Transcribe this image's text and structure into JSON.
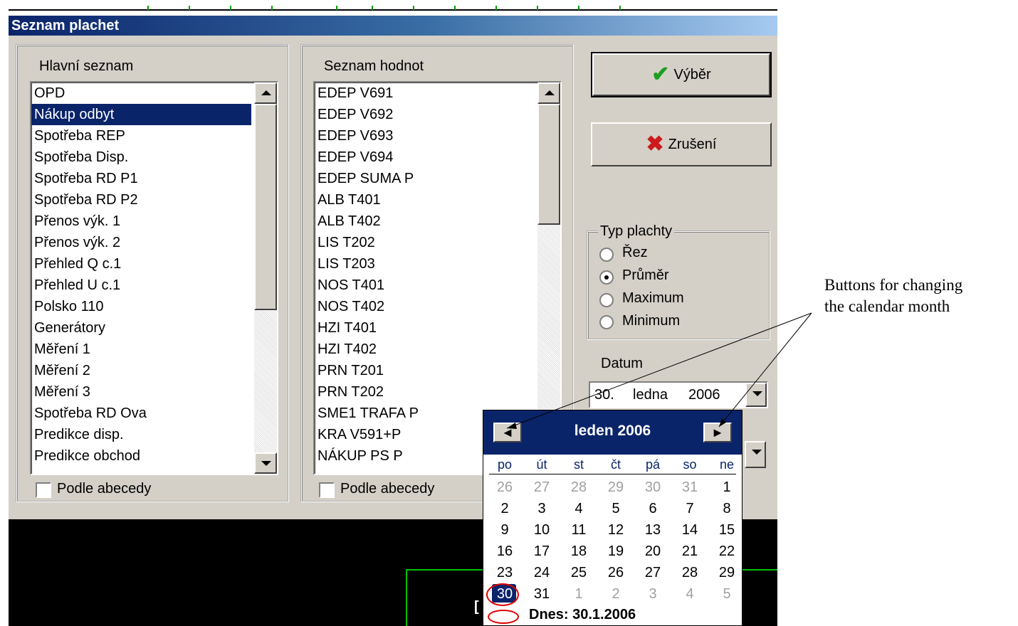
{
  "window": {
    "title": "Seznam plachet"
  },
  "main_list": {
    "label": "Hlavní seznam",
    "items": [
      "OPD",
      "Nákup odbyt",
      "Spotřeba REP",
      "Spotřeba Disp.",
      "Spotřeba RD P1",
      "Spotřeba RD P2",
      "Přenos výk. 1",
      "Přenos výk. 2",
      "Přehled Q c.1",
      "Přehled U c.1",
      "Polsko 110",
      "Generátory",
      "Měření 1",
      "Měření 2",
      "Měření 3",
      "Spotřeba RD Ova",
      "Predikce disp.",
      "Predikce obchod"
    ],
    "selected": "Nákup odbyt",
    "sort_label": "Podle abecedy"
  },
  "value_list": {
    "label": "Seznam hodnot",
    "items": [
      "EDEP V691",
      "EDEP V692",
      "EDEP V693",
      "EDEP V694",
      "EDEP SUMA P",
      "ALB T401",
      "ALB T402",
      "LIS T202",
      "LIS T203",
      "NOS T401",
      "NOS T402",
      "HZI T401",
      "HZI T402",
      "PRN T201",
      "PRN T202",
      "SME1 TRAFA P",
      "KRA V591+P",
      "NÁKUP PS P"
    ],
    "sort_label": "Podle abecedy"
  },
  "buttons": {
    "select_label": "Výběr",
    "cancel_label": "Zrušení"
  },
  "type_group": {
    "label": "Typ plachty",
    "options": [
      "Řez",
      "Průměr",
      "Maximum",
      "Minimum"
    ],
    "selected": "Průměr"
  },
  "date": {
    "label": "Datum",
    "day": "30.",
    "month": "ledna",
    "year": "2006"
  },
  "calendar": {
    "title": "leden 2006",
    "prev_icon": "arrow-left-icon",
    "next_icon": "arrow-right-icon",
    "weekdays": [
      "po",
      "út",
      "st",
      "čt",
      "pá",
      "so",
      "ne"
    ],
    "weeks": [
      [
        "26",
        "27",
        "28",
        "29",
        "30",
        "31",
        "1"
      ],
      [
        "2",
        "3",
        "4",
        "5",
        "6",
        "7",
        "8"
      ],
      [
        "9",
        "10",
        "11",
        "12",
        "13",
        "14",
        "15"
      ],
      [
        "16",
        "17",
        "18",
        "19",
        "20",
        "21",
        "22"
      ],
      [
        "23",
        "24",
        "25",
        "26",
        "27",
        "28",
        "29"
      ],
      [
        "30",
        "31",
        "1",
        "2",
        "3",
        "4",
        "5"
      ]
    ],
    "today_label": "Dnes: 30.1.2006"
  },
  "annotation": {
    "line1": "Buttons for changing",
    "line2": "the calendar month"
  },
  "colors": {
    "selection": "#0a246a",
    "face": "#d4d0c8",
    "highlight_circle": "#e00000",
    "check": "#1e9e1e",
    "cross": "#cc1b1b"
  }
}
